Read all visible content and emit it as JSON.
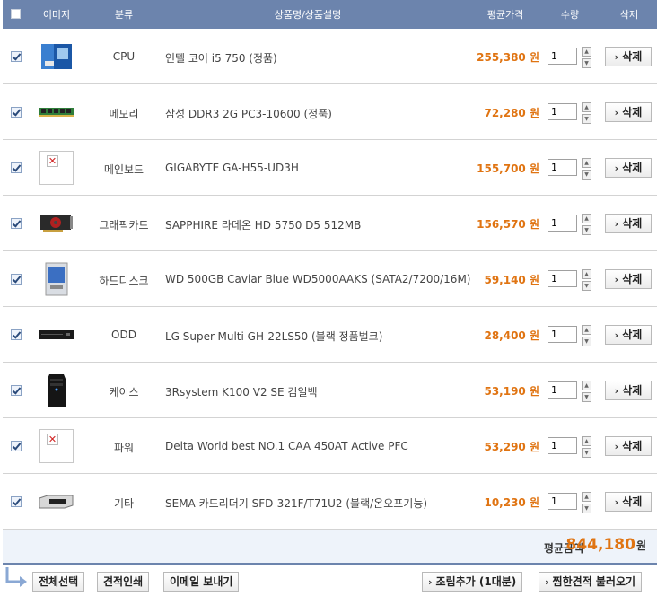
{
  "header": {
    "image": "이미지",
    "category": "분류",
    "product": "상품명/상품설명",
    "price": "평균가격",
    "qty": "수량",
    "delete": "삭제"
  },
  "rows": [
    {
      "category": "CPU",
      "name": "인텔 코어 i5 750 (정품)",
      "price": "255,380 원",
      "qty": "1",
      "delete": "삭제",
      "icon": "cpu-box-icon"
    },
    {
      "category": "메모리",
      "name": "삼성 DDR3 2G PC3-10600 (정품)",
      "price": "72,280 원",
      "qty": "1",
      "delete": "삭제",
      "icon": "ram-stick-icon"
    },
    {
      "category": "메인보드",
      "name": "GIGABYTE GA-H55-UD3H",
      "price": "155,700 원",
      "qty": "1",
      "delete": "삭제",
      "icon": "broken-image-icon"
    },
    {
      "category": "그래픽카드",
      "name": "SAPPHIRE 라데온 HD 5750 D5 512MB",
      "price": "156,570 원",
      "qty": "1",
      "delete": "삭제",
      "icon": "graphics-card-icon"
    },
    {
      "category": "하드디스크",
      "name": "WD 500GB Caviar Blue WD5000AAKS (SATA2/7200/16M)",
      "price": "59,140 원",
      "qty": "1",
      "delete": "삭제",
      "icon": "hard-disk-icon"
    },
    {
      "category": "ODD",
      "name": "LG Super-Multi GH-22LS50 (블랙 정품벌크)",
      "price": "28,400 원",
      "qty": "1",
      "delete": "삭제",
      "icon": "optical-drive-icon"
    },
    {
      "category": "케이스",
      "name": "3Rsystem K100 V2 SE 김일백",
      "price": "53,190 원",
      "qty": "1",
      "delete": "삭제",
      "icon": "pc-case-icon"
    },
    {
      "category": "파워",
      "name": "Delta World best NO.1 CAA 450AT Active PFC",
      "price": "53,290 원",
      "qty": "1",
      "delete": "삭제",
      "icon": "broken-image-icon"
    },
    {
      "category": "기타",
      "name": "SEMA 카드리더기 SFD-321F/T71U2 (블랙/온오프기능)",
      "price": "10,230 원",
      "qty": "1",
      "delete": "삭제",
      "icon": "card-reader-icon"
    }
  ],
  "total": {
    "label": "평균금액",
    "value": "844,180",
    "unit": "원"
  },
  "footer": {
    "select_all": "전체선택",
    "print_quote": "견적인쇄",
    "send_email": "이메일 보내기",
    "add_assembly": "조립추가 (1대분)",
    "load_saved": "찜한견적 불러오기"
  },
  "colors": {
    "header_bg": "#6c84ad",
    "price": "#e07412",
    "total_bg": "#eef3fa"
  }
}
